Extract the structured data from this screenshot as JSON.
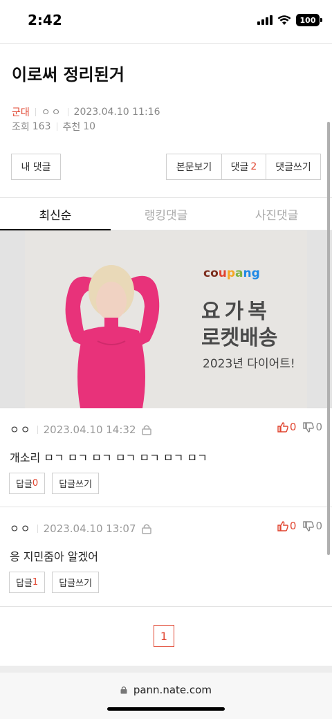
{
  "status": {
    "time": "2:42",
    "battery": "100"
  },
  "post": {
    "title": "이로써 정리된거",
    "category": "군대",
    "author": "ㅇㅇ",
    "datetime": "2023.04.10 11:16",
    "views_label": "조회",
    "views": "163",
    "recommend_label": "추천",
    "recommend": "10"
  },
  "buttons": {
    "my_comments": "내 댓글",
    "view_body": "본문보기",
    "comments_label": "댓글",
    "comments_count": "2",
    "write_comment": "댓글쓰기"
  },
  "tabs": [
    {
      "label": "최신순",
      "active": true
    },
    {
      "label": "랭킹댓글",
      "active": false
    },
    {
      "label": "사진댓글",
      "active": false
    }
  ],
  "ad": {
    "brand": "coupang",
    "brand_colors": [
      "#7d2e1e",
      "#e0442f",
      "#f5a623",
      "#7cb342",
      "#1e88e5"
    ],
    "line1": "요가복",
    "line2": "로켓배송",
    "line3": "2023년 다이어트!",
    "accent": "#e8327a"
  },
  "comments": [
    {
      "author": "ㅇㅇ",
      "datetime": "2023.04.10 14:32",
      "up": "0",
      "down": "0",
      "text": "개소리 ㅁㄱ ㅁㄱ ㅁㄱ ㅁㄱ ㅁㄱ ㅁㄱ ㅁㄱ",
      "reply_label": "답글",
      "reply_count": "0",
      "write_reply": "답글쓰기"
    },
    {
      "author": "ㅇㅇ",
      "datetime": "2023.04.10 13:07",
      "up": "0",
      "down": "0",
      "text": "응 지민줌아 알겠어",
      "reply_label": "답글",
      "reply_count": "1",
      "write_reply": "답글쓰기"
    }
  ],
  "pagination": {
    "current": "1"
  },
  "browser": {
    "url": "pann.nate.com"
  },
  "colors": {
    "accent_red": "#e0442f"
  }
}
